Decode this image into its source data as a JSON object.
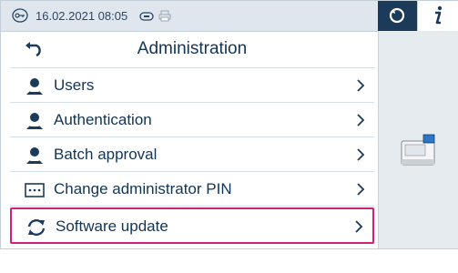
{
  "status_bar": {
    "datetime": "16.02.2021 08:05"
  },
  "menu": {
    "title": "Administration",
    "items": [
      {
        "label": "Users"
      },
      {
        "label": "Authentication"
      },
      {
        "label": "Batch approval"
      },
      {
        "label": "Change administrator PIN"
      },
      {
        "label": "Software update"
      }
    ]
  },
  "colors": {
    "highlight": "#d1207a",
    "accent_dark": "#1c3a59",
    "text": "#123456"
  },
  "icons": {
    "status": [
      "key-icon",
      "card-icon",
      "printer-icon"
    ],
    "side": [
      "refresh-icon",
      "info-icon",
      "device-icon"
    ],
    "items": [
      "user-icon",
      "user-icon",
      "user-icon",
      "pin-icon",
      "update-icon"
    ]
  }
}
